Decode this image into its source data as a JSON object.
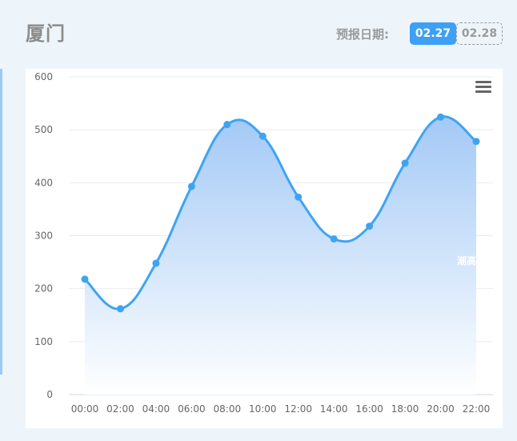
{
  "header": {
    "city": "厦门",
    "date_label": "预报日期:",
    "dates": [
      {
        "label": "02.27",
        "active": true
      },
      {
        "label": "02.28",
        "active": false
      }
    ]
  },
  "chart_data": {
    "type": "area",
    "title": "",
    "xlabel": "",
    "ylabel": "",
    "categories": [
      "00:00",
      "02:00",
      "04:00",
      "06:00",
      "08:00",
      "10:00",
      "12:00",
      "14:00",
      "16:00",
      "18:00",
      "20:00",
      "22:00"
    ],
    "series": [
      {
        "name": "潮高",
        "values": [
          218,
          162,
          248,
          393,
          510,
          488,
          373,
          294,
          318,
          437,
          524,
          478
        ]
      }
    ],
    "ylim": [
      0,
      600
    ],
    "yticks": [
      0,
      100,
      200,
      300,
      400,
      500,
      600
    ],
    "grid": true,
    "colors": {
      "line": "#3ea4f2",
      "point": "#3ea4f2",
      "area_top": "#a3c9f6",
      "area_bottom": "#ffffff"
    }
  },
  "accent_color": "#3ea0f5"
}
